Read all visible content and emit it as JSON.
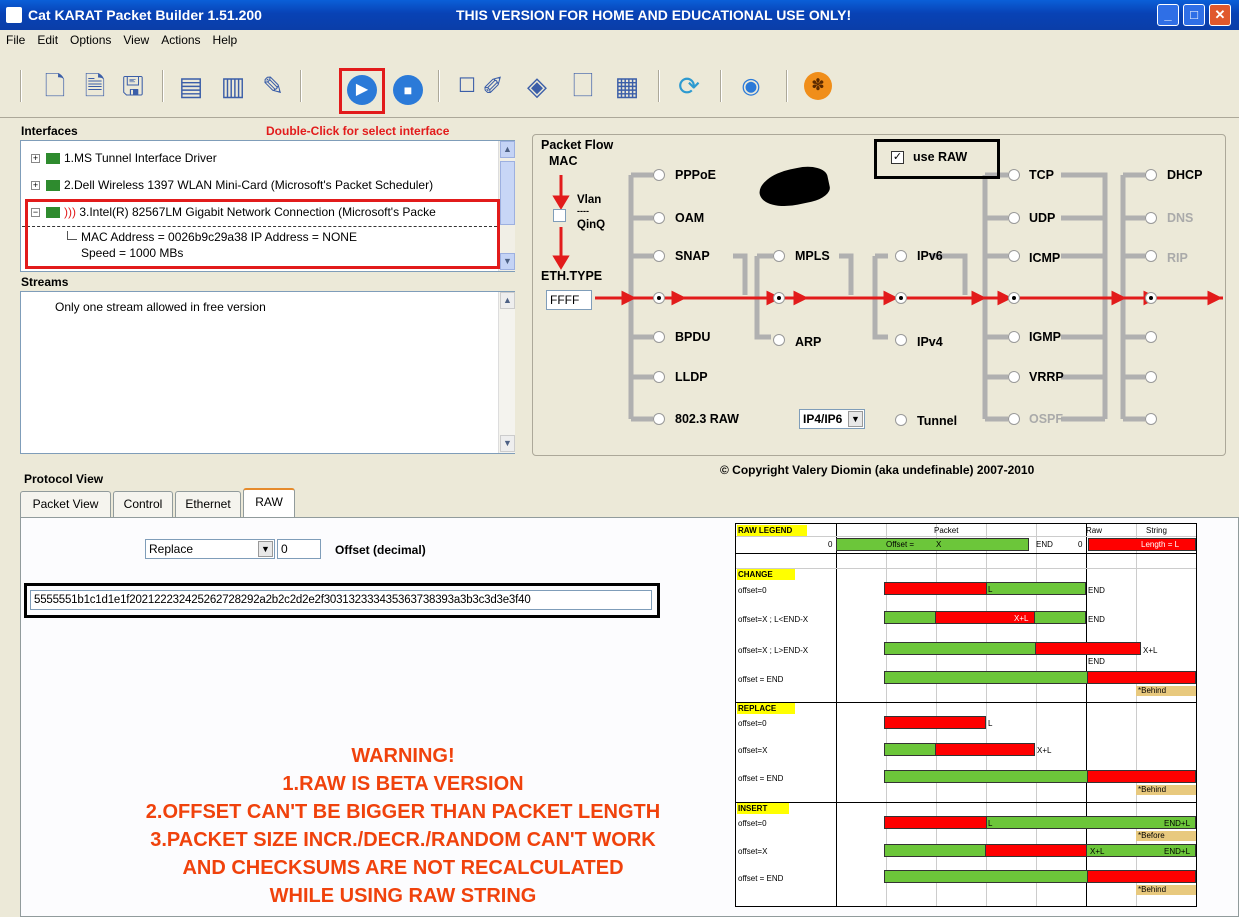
{
  "window": {
    "title": "Cat KARAT Packet Builder 1.51.200",
    "banner": "THIS VERSION FOR HOME AND EDUCATIONAL USE ONLY!"
  },
  "menu": [
    "File",
    "Edit",
    "Options",
    "View",
    "Actions",
    "Help"
  ],
  "interfaces": {
    "label": "Interfaces",
    "hint": "Double-Click for select interface",
    "items": [
      "1.MS Tunnel Interface Driver",
      "2.Dell Wireless 1397 WLAN Mini-Card (Microsoft's Packet Scheduler)",
      "3.Intel(R) 82567LM Gigabit Network Connection (Microsoft's Packe"
    ],
    "detail1": "MAC Address = 0026b9c29a38 IP Address = NONE",
    "detail2": "Speed = 1000 MBs"
  },
  "streams": {
    "label": "Streams",
    "text": "Only one stream allowed in free version"
  },
  "flow": {
    "label": "Packet Flow",
    "mac": "MAC",
    "vlan": "Vlan",
    "dash": "----",
    "qinq": "QinQ",
    "ethtype": "ETH.TYPE",
    "ethvalue": "FFFF",
    "use_raw": "use RAW",
    "col1": [
      "PPPoE",
      "OAM",
      "SNAP",
      "BPDU",
      "LLDP",
      "802.3 RAW"
    ],
    "mpls": "MPLS",
    "arp": "ARP",
    "ipv6": "IPv6",
    "ipv4": "IPv4",
    "tunnel": "Tunnel",
    "ip_select": "IP4/IP6",
    "col4": [
      "TCP",
      "UDP",
      "ICMP",
      "IGMP",
      "VRRP",
      "OSPF"
    ],
    "col5": [
      "DHCP",
      "DNS",
      "RIP"
    ]
  },
  "copyright": "© Copyright Valery Diomin (aka undefinable) 2007-2010",
  "protocol_view": {
    "label": "Protocol View",
    "tabs": [
      "Packet View",
      "Control",
      "Ethernet",
      "RAW"
    ]
  },
  "raw": {
    "mode": "Replace",
    "offset": "0",
    "offset_label": "Offset (decimal)",
    "hex": "5555551b1c1d1e1f202122232425262728292a2b2c2d2e2f303132333435363738393a3b3c3d3e3f40"
  },
  "warning": [
    "WARNING!",
    "1.RAW IS BETA VERSION",
    "2.OFFSET CAN'T BE BIGGER THAN PACKET LENGTH",
    "3.PACKET SIZE INCR./DECR./RANDOM CAN'T WORK",
    "AND CHECKSUMS ARE NOT RECALCULATED",
    "WHILE USING RAW STRING"
  ],
  "legend": {
    "title": "RAW LEGEND",
    "packet": "Packet",
    "raw": "Raw",
    "string": "String",
    "zero": "0",
    "offset_eq": "Offset =",
    "x": "X",
    "end": "END",
    "length": "Length = L",
    "change": "CHANGE",
    "replace": "REPLACE",
    "insert": "INSERT",
    "r_offset0": "offset=0",
    "r_offsetX_lt": "offset=X ; L<END-X",
    "r_offsetX_gt": "offset=X ; L>END-X",
    "r_offsetEnd": "offset = END",
    "r_offsetX": "offset=X",
    "L": "L",
    "XL": "X+L",
    "endL": "END+L",
    "behind": "*Behind",
    "before": "*Before"
  },
  "colors": {
    "accent_red": "#e21b1b",
    "warning": "#f0420c",
    "legend_green": "#6cc63a",
    "legend_red": "#ff0000",
    "legend_yellow": "#ffff00",
    "title_blue": "#0842b5"
  }
}
